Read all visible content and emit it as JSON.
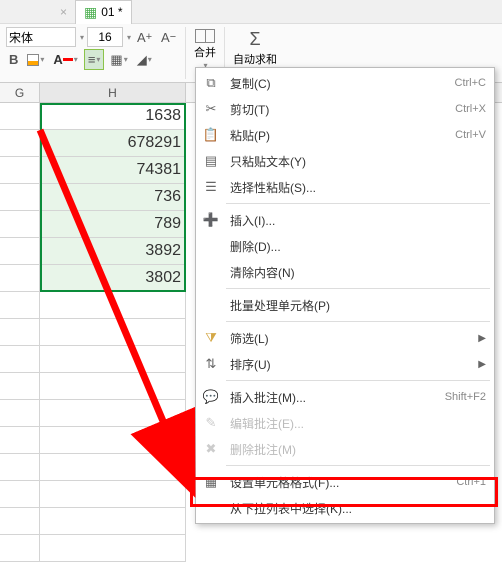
{
  "tab": {
    "close": "×",
    "label": "01 *"
  },
  "ribbon": {
    "font_name": "宋体",
    "font_size": "16",
    "merge_label": "合并",
    "autosum_label": "自动求和"
  },
  "columns": {
    "g": "G",
    "h": "H"
  },
  "cells": {
    "h_values": [
      "1638",
      "678291",
      "74381",
      "736",
      "789",
      "3892",
      "3802"
    ]
  },
  "menu": {
    "copy": {
      "label": "复制(C)",
      "shortcut": "Ctrl+C"
    },
    "cut": {
      "label": "剪切(T)",
      "shortcut": "Ctrl+X"
    },
    "paste": {
      "label": "粘贴(P)",
      "shortcut": "Ctrl+V"
    },
    "paste_text": {
      "label": "只粘贴文本(Y)"
    },
    "paste_special": {
      "label": "选择性粘贴(S)..."
    },
    "insert": {
      "label": "插入(I)..."
    },
    "delete": {
      "label": "删除(D)..."
    },
    "clear": {
      "label": "清除内容(N)"
    },
    "batch": {
      "label": "批量处理单元格(P)"
    },
    "filter": {
      "label": "筛选(L)"
    },
    "sort": {
      "label": "排序(U)"
    },
    "insert_comment": {
      "label": "插入批注(M)...",
      "shortcut": "Shift+F2"
    },
    "edit_comment": {
      "label": "编辑批注(E)..."
    },
    "del_comment": {
      "label": "删除批注(M)"
    },
    "format_cells": {
      "label": "设置单元格格式(F)...",
      "shortcut": "Ctrl+1"
    },
    "from_dropdown": {
      "label": "从下拉列表中选择(K)..."
    }
  }
}
